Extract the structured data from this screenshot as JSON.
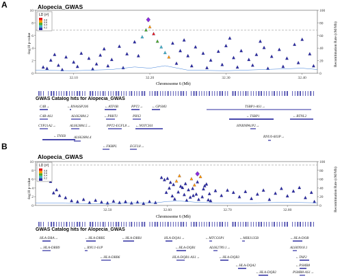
{
  "panels": [
    {
      "letter": "A",
      "title": "Alopecia_GWAS",
      "catalog_title": "GWAS Catalog hits for Alopecia_GWAS",
      "genes": [
        "C4B→",
        "←RNASSP206",
        "←ATF6B",
        "PPT2→",
        "←GPSM3",
        "C4B-AS1",
        "AL662884.2",
        "←PRRT1",
        "PBX2",
        "CYP21A2→",
        "AL662884.5→",
        "PPT2-EGFL8→",
        "←NOTCH4",
        "←TNXB",
        "AL662884.4",
        "←FKBPL",
        "EGFL8→",
        "TSBP1-AS1→",
        "←TSBP1",
        "HNRNPA1P2→",
        "←BTNL2",
        "RNU6-603P→"
      ]
    },
    {
      "letter": "B",
      "title": "Alopecia_GWAS",
      "catalog_title": "GWAS Catalog hits for Alopecia_GWAS",
      "genes": [
        "HLA-DRA→",
        "←HLA-DRB5",
        "←HLA-DRB1",
        "HLA-DQA1→",
        "←MTCO3P1",
        "←MIR3135B",
        "←HLA-DOB",
        "←HLA-DRB9",
        "←RNU1-61P",
        "←HLA-DQB1",
        "AL662789.1→",
        "AL669918.1",
        "←HLA-DRB6",
        "HLA-DQB1-AS1→",
        "←HLA-DQB3",
        "←TAP2",
        "←HLA-DQA2",
        "←PSMB8",
        "←HLA-DQB2",
        "PSMB8-AS1→"
      ]
    }
  ],
  "chart_data": [
    {
      "type": "scatter",
      "panel": "A",
      "title": "Alopecia_GWAS",
      "xlabel": "Chromosome 6 (Mb)",
      "ylabel": "-log10 p-value",
      "y2label": "Recombination Rate (cM/Mb)",
      "xlim": [
        32.05,
        32.42
      ],
      "ylim": [
        0,
        10
      ],
      "y2lim": [
        0,
        100
      ],
      "x_ticks": [
        32.1,
        32.2,
        32.3,
        32.4
      ],
      "x_tick_labels": [
        "32.10",
        "32.20",
        "32.30",
        "32.40"
      ],
      "y_ticks": [
        0,
        2,
        4,
        6,
        8,
        10
      ],
      "y2_ticks": [
        0,
        20,
        40,
        60,
        80,
        100
      ],
      "threshold_y": 7.3,
      "legend": {
        "title": "LD (r²)",
        "labels": [
          "0.8",
          "0.6",
          "0.4",
          "0.2"
        ],
        "colors": [
          "#e41a1c",
          "#ff9900",
          "#4dac26",
          "#41b6c4",
          "#2c2ca0"
        ],
        "position": "top-left"
      },
      "lead": {
        "x": 32.198,
        "y": 8.5,
        "color": "#8b2be2"
      },
      "points": [
        [
          32.06,
          1.0,
          0
        ],
        [
          32.07,
          2.1,
          0
        ],
        [
          32.08,
          1.3,
          0
        ],
        [
          32.09,
          2.6,
          0
        ],
        [
          32.1,
          1.8,
          0
        ],
        [
          32.11,
          3.2,
          0
        ],
        [
          32.12,
          2.4,
          0
        ],
        [
          32.13,
          1.5,
          0
        ],
        [
          32.14,
          3.9,
          0
        ],
        [
          32.15,
          2.2,
          0
        ],
        [
          32.16,
          4.3,
          0
        ],
        [
          32.17,
          3.1,
          0
        ],
        [
          32.18,
          5.0,
          0
        ],
        [
          32.19,
          5.8,
          1
        ],
        [
          32.195,
          6.9,
          2
        ],
        [
          32.2,
          7.4,
          3
        ],
        [
          32.205,
          6.3,
          4
        ],
        [
          32.21,
          5.1,
          2
        ],
        [
          32.215,
          4.2,
          1
        ],
        [
          32.22,
          3.3,
          1
        ],
        [
          32.225,
          2.6,
          3
        ],
        [
          32.23,
          4.8,
          0
        ],
        [
          32.24,
          3.6,
          0
        ],
        [
          32.25,
          2.8,
          0
        ],
        [
          32.26,
          4.2,
          0
        ],
        [
          32.27,
          3.2,
          0
        ],
        [
          32.28,
          2.1,
          0
        ],
        [
          32.29,
          3.5,
          0
        ],
        [
          32.3,
          4.4,
          0
        ],
        [
          32.31,
          2.5,
          0
        ],
        [
          32.32,
          3.6,
          0
        ],
        [
          32.33,
          2.2,
          0
        ],
        [
          32.34,
          3.0,
          0
        ],
        [
          32.35,
          4.1,
          0
        ],
        [
          32.36,
          2.7,
          0
        ],
        [
          32.37,
          3.8,
          0
        ],
        [
          32.38,
          2.4,
          0
        ],
        [
          32.39,
          4.6,
          0
        ],
        [
          32.4,
          5.4,
          0
        ],
        [
          32.41,
          3.1,
          0
        ],
        [
          32.065,
          0.8,
          0
        ],
        [
          32.085,
          0.6,
          0
        ],
        [
          32.105,
          1.1,
          0
        ],
        [
          32.125,
          0.7,
          0
        ],
        [
          32.145,
          1.2,
          0
        ],
        [
          32.165,
          0.9,
          0
        ],
        [
          32.185,
          2.8,
          0
        ],
        [
          32.235,
          1.6,
          0
        ],
        [
          32.255,
          1.2,
          0
        ],
        [
          32.275,
          0.9,
          0
        ],
        [
          32.295,
          1.4,
          0
        ],
        [
          32.315,
          1.0,
          0
        ],
        [
          32.335,
          1.3,
          0
        ],
        [
          32.355,
          0.8,
          0
        ],
        [
          32.375,
          1.1,
          0
        ],
        [
          32.395,
          1.7,
          0
        ],
        [
          32.415,
          1.2,
          0
        ],
        [
          32.075,
          3.0,
          0
        ],
        [
          32.135,
          2.9,
          0
        ],
        [
          32.245,
          5.3,
          0
        ],
        [
          32.305,
          5.6,
          0
        ],
        [
          32.345,
          5.1,
          0
        ]
      ],
      "recombination": [
        [
          32.05,
          5
        ],
        [
          32.1,
          4
        ],
        [
          32.15,
          6
        ],
        [
          32.18,
          10
        ],
        [
          32.2,
          8
        ],
        [
          32.22,
          12
        ],
        [
          32.25,
          5
        ],
        [
          32.3,
          4
        ],
        [
          32.35,
          6
        ],
        [
          32.4,
          8
        ],
        [
          32.42,
          6
        ]
      ]
    },
    {
      "type": "scatter",
      "panel": "B",
      "title": "Alopecia_GWAS",
      "xlabel": "Chromosome 6 (Mb)",
      "ylabel": "-log10 p-value",
      "y2label": "Recombination Rate (cM/Mb)",
      "xlim": [
        32.38,
        32.85
      ],
      "ylim": [
        0,
        10
      ],
      "y2lim": [
        0,
        100
      ],
      "x_ticks": [
        32.5,
        32.6,
        32.7,
        32.8
      ],
      "x_tick_labels": [
        "32.50",
        "32.60",
        "32.70",
        "32.80"
      ],
      "y_ticks": [
        0,
        2,
        4,
        6,
        8,
        10
      ],
      "y2_ticks": [
        0,
        20,
        40,
        60,
        80,
        100
      ],
      "threshold_y": 7.3,
      "legend": {
        "title": "LD (r²)",
        "labels": [
          "0.8",
          "0.6",
          "0.4",
          "0.2"
        ],
        "colors": [
          "#e41a1c",
          "#ff9900",
          "#4dac26",
          "#41b6c4",
          "#2c2ca0"
        ],
        "position": "top-left"
      },
      "lead": {
        "x": 32.65,
        "y": 7.2,
        "color": "#8b2be2"
      },
      "points": [
        [
          32.39,
          6.8,
          3
        ],
        [
          32.395,
          7.2,
          3
        ],
        [
          32.4,
          6.1,
          0
        ],
        [
          32.405,
          5.5,
          0
        ],
        [
          32.41,
          2.9,
          0
        ],
        [
          32.415,
          3.6,
          0
        ],
        [
          32.42,
          2.3,
          0
        ],
        [
          32.43,
          1.8,
          0
        ],
        [
          32.44,
          1.1,
          0
        ],
        [
          32.45,
          0.9,
          0
        ],
        [
          32.46,
          1.4,
          0
        ],
        [
          32.47,
          0.7,
          0
        ],
        [
          32.48,
          1.2,
          0
        ],
        [
          32.49,
          0.8,
          0
        ],
        [
          32.5,
          0.6,
          0
        ],
        [
          32.51,
          1.0,
          0
        ],
        [
          32.52,
          0.7,
          0
        ],
        [
          32.53,
          0.9,
          0
        ],
        [
          32.54,
          0.6,
          0
        ],
        [
          32.55,
          0.8,
          0
        ],
        [
          32.56,
          0.5,
          0
        ],
        [
          32.57,
          0.9,
          0
        ],
        [
          32.58,
          0.7,
          0
        ],
        [
          32.59,
          6.4,
          0
        ],
        [
          32.595,
          5.9,
          0
        ],
        [
          32.6,
          6.2,
          0
        ],
        [
          32.605,
          5.3,
          0
        ],
        [
          32.61,
          4.8,
          0
        ],
        [
          32.615,
          5.6,
          3
        ],
        [
          32.62,
          6.8,
          3
        ],
        [
          32.625,
          4.1,
          0
        ],
        [
          32.63,
          5.0,
          0
        ],
        [
          32.635,
          3.6,
          0
        ],
        [
          32.64,
          6.1,
          3
        ],
        [
          32.645,
          4.7,
          3
        ],
        [
          32.65,
          5.4,
          0
        ],
        [
          32.655,
          6.6,
          3
        ],
        [
          32.66,
          3.8,
          0
        ],
        [
          32.665,
          4.9,
          0
        ],
        [
          32.67,
          2.7,
          0
        ],
        [
          32.68,
          3.4,
          0
        ],
        [
          32.69,
          2.3,
          0
        ],
        [
          32.7,
          3.5,
          0
        ],
        [
          32.71,
          3.0,
          0
        ],
        [
          32.72,
          2.0,
          0
        ],
        [
          32.73,
          3.2,
          0
        ],
        [
          32.74,
          1.6,
          0
        ],
        [
          32.75,
          2.6,
          0
        ],
        [
          32.76,
          3.5,
          0
        ],
        [
          32.77,
          1.4,
          0
        ],
        [
          32.78,
          2.8,
          0
        ],
        [
          32.79,
          3.9,
          0
        ],
        [
          32.8,
          2.2,
          0
        ],
        [
          32.81,
          3.3,
          0
        ],
        [
          32.82,
          4.1,
          0
        ],
        [
          32.83,
          1.8,
          0
        ],
        [
          32.84,
          3.0,
          0
        ],
        [
          32.845,
          0.9,
          0
        ],
        [
          32.598,
          3.0,
          0
        ],
        [
          32.608,
          2.2,
          0
        ],
        [
          32.618,
          3.1,
          0
        ],
        [
          32.628,
          2.5,
          0
        ],
        [
          32.638,
          1.9,
          0
        ],
        [
          32.648,
          2.6,
          0
        ],
        [
          32.658,
          2.0,
          0
        ],
        [
          32.668,
          1.3,
          0
        ],
        [
          32.612,
          1.5,
          0
        ],
        [
          32.632,
          1.2,
          0
        ],
        [
          32.652,
          1.4,
          0
        ],
        [
          32.672,
          1.1,
          0
        ],
        [
          32.622,
          4.4,
          0
        ],
        [
          32.642,
          3.9,
          0
        ],
        [
          32.662,
          4.5,
          0
        ],
        [
          32.603,
          4.0,
          0
        ],
        [
          32.643,
          2.3,
          0
        ]
      ],
      "recombination": [
        [
          32.38,
          6
        ],
        [
          32.43,
          5
        ],
        [
          32.48,
          4
        ],
        [
          32.53,
          5
        ],
        [
          32.58,
          6
        ],
        [
          32.6,
          9
        ],
        [
          32.62,
          10
        ],
        [
          32.65,
          7
        ],
        [
          32.7,
          5
        ],
        [
          32.75,
          6
        ],
        [
          32.8,
          7
        ],
        [
          32.85,
          6
        ]
      ]
    }
  ]
}
